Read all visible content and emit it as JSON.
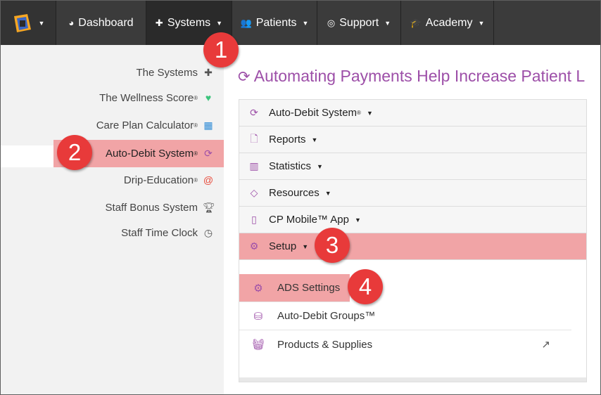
{
  "nav": {
    "dashboard": "Dashboard",
    "systems": "Systems",
    "patients": "Patients",
    "support": "Support",
    "academy": "Academy"
  },
  "sidebar": {
    "items": [
      {
        "label": "The Systems",
        "reg": "",
        "icon": "puzzle-icon"
      },
      {
        "label": "The Wellness Score",
        "reg": "®",
        "icon": "heart-pulse-icon"
      },
      {
        "label": "Care Plan Calculator",
        "reg": "®",
        "icon": "calculator-icon"
      },
      {
        "label": "Auto-Debit System",
        "reg": "®",
        "icon": "refresh-icon"
      },
      {
        "label": "Drip-Education",
        "reg": "®",
        "icon": "at-icon"
      },
      {
        "label": "Staff Bonus System",
        "reg": "",
        "icon": "trophy-icon"
      },
      {
        "label": "Staff Time Clock",
        "reg": "",
        "icon": "clock-icon"
      }
    ]
  },
  "main": {
    "title": "Automating Payments Help Increase Patient L",
    "rows": [
      {
        "label": "Auto-Debit System",
        "reg": "®"
      },
      {
        "label": "Reports"
      },
      {
        "label": "Statistics"
      },
      {
        "label": "Resources"
      },
      {
        "label": "CP Mobile™ App"
      },
      {
        "label": "Setup"
      }
    ],
    "sub": [
      {
        "label": "ADS Settings"
      },
      {
        "label": "Auto-Debit Groups™"
      },
      {
        "label": "Products & Supplies"
      }
    ]
  },
  "badges": [
    "1",
    "2",
    "3",
    "4"
  ],
  "colors": {
    "nav_bg": "#3b3b3b",
    "accent": "#9d4fa8",
    "highlight": "#f1a4a6",
    "badge": "#e83a3a"
  }
}
